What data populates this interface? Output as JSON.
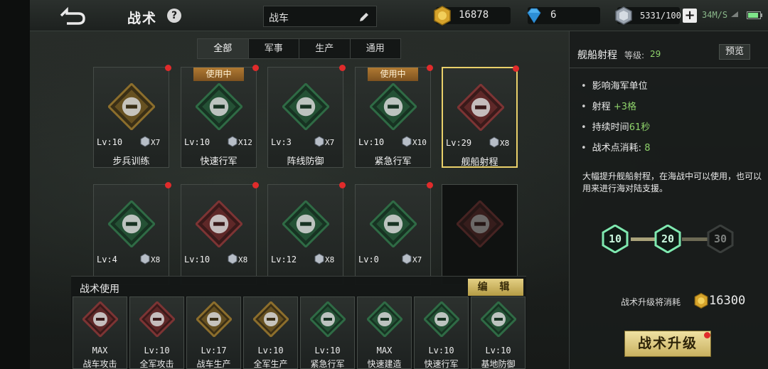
{
  "header": {
    "title": "战术",
    "help": "?",
    "search_text": "战车",
    "gold": "16878",
    "diamonds": "6",
    "steel": "5331/100",
    "net_speed": "34M/S"
  },
  "tabs": [
    {
      "label": "全部",
      "active": true
    },
    {
      "label": "军事",
      "active": false
    },
    {
      "label": "生产",
      "active": false
    },
    {
      "label": "通用",
      "active": false
    }
  ],
  "cards": [
    {
      "name": "步兵训练",
      "lv": "Lv:10",
      "cost": "X7",
      "in_use": false,
      "in_use_label": "",
      "red_dot": true,
      "selected": false,
      "icon": "runner-icon",
      "theme": "gold"
    },
    {
      "name": "快速行军",
      "lv": "Lv:10",
      "cost": "X12",
      "in_use": true,
      "in_use_label": "使用中",
      "red_dot": true,
      "selected": false,
      "icon": "speed-march-icon",
      "theme": "green"
    },
    {
      "name": "阵线防御",
      "lv": "Lv:3",
      "cost": "X7",
      "in_use": false,
      "in_use_label": "",
      "red_dot": true,
      "selected": false,
      "icon": "cannon-icon",
      "theme": "green"
    },
    {
      "name": "紧急行军",
      "lv": "Lv:10",
      "cost": "X10",
      "in_use": true,
      "in_use_label": "使用中",
      "red_dot": true,
      "selected": false,
      "icon": "soldiers-icon",
      "theme": "green"
    },
    {
      "name": "舰船射程",
      "lv": "Lv:29",
      "cost": "X8",
      "in_use": false,
      "in_use_label": "",
      "red_dot": true,
      "selected": true,
      "icon": "battleship-icon",
      "theme": "red"
    },
    {
      "name": "",
      "lv": "Lv:4",
      "cost": "X8",
      "in_use": false,
      "in_use_label": "",
      "red_dot": true,
      "selected": false,
      "icon": "radar-tower-icon",
      "theme": "green"
    },
    {
      "name": "",
      "lv": "Lv:10",
      "cost": "X8",
      "in_use": false,
      "in_use_label": "",
      "red_dot": true,
      "selected": false,
      "icon": "shield-icon",
      "theme": "red"
    },
    {
      "name": "",
      "lv": "Lv:12",
      "cost": "X8",
      "in_use": false,
      "in_use_label": "",
      "red_dot": true,
      "selected": false,
      "icon": "aircraft-icon",
      "theme": "green"
    },
    {
      "name": "",
      "lv": "Lv:0",
      "cost": "X7",
      "in_use": false,
      "in_use_label": "",
      "red_dot": true,
      "selected": false,
      "icon": "watchtower-icon",
      "theme": "green"
    },
    {
      "name": "",
      "lv": "",
      "cost": "",
      "in_use": false,
      "in_use_label": "",
      "red_dot": false,
      "selected": false,
      "locked": true,
      "icon": "lock-icon",
      "theme": "dark"
    }
  ],
  "bottom": {
    "title": "战术使用",
    "edit_label": "编 辑",
    "slots": [
      {
        "lv": "MAX",
        "name": "战车攻击",
        "icon": "tank-attack-icon",
        "theme": "red"
      },
      {
        "lv": "Lv:10",
        "name": "全军攻击",
        "icon": "soldier-attack-icon",
        "theme": "red"
      },
      {
        "lv": "Lv:17",
        "name": "战车生产",
        "icon": "tank-icon",
        "theme": "gold"
      },
      {
        "lv": "Lv:10",
        "name": "全军生产",
        "icon": "factory-icon",
        "theme": "gold"
      },
      {
        "lv": "Lv:10",
        "name": "紧急行军",
        "icon": "soldiers-icon",
        "theme": "green"
      },
      {
        "lv": "MAX",
        "name": "快速建造",
        "icon": "crane-icon",
        "theme": "green"
      },
      {
        "lv": "Lv:10",
        "name": "快速行军",
        "icon": "speed-march-icon",
        "theme": "green"
      },
      {
        "lv": "Lv:10",
        "name": "基地防御",
        "icon": "shield-icon",
        "theme": "green"
      }
    ]
  },
  "detail": {
    "name": "舰船射程",
    "level_label": "等级:",
    "level": "29",
    "preview_label": "预览",
    "attrs": [
      {
        "label": "影响海军单位",
        "value": ""
      },
      {
        "label": "射程 ",
        "value": "+3格"
      },
      {
        "label": "持续时间",
        "value": "61秒"
      },
      {
        "label": "战术点消耗: ",
        "value": "8"
      }
    ],
    "description": "大幅提升舰船射程，在海战中可以使用，也可以用来进行海对陆支援。",
    "tiers": [
      "10",
      "20",
      "30"
    ],
    "upgrade_cost_label": "战术升级将消耗",
    "upgrade_cost": "16300",
    "upgrade_label": "战术升级"
  },
  "colors": {
    "accent_gold": "#e9d06a",
    "value_green": "#8fd36b",
    "red_dot": "#e02b2b",
    "tier_active": "#7fe9b0"
  }
}
